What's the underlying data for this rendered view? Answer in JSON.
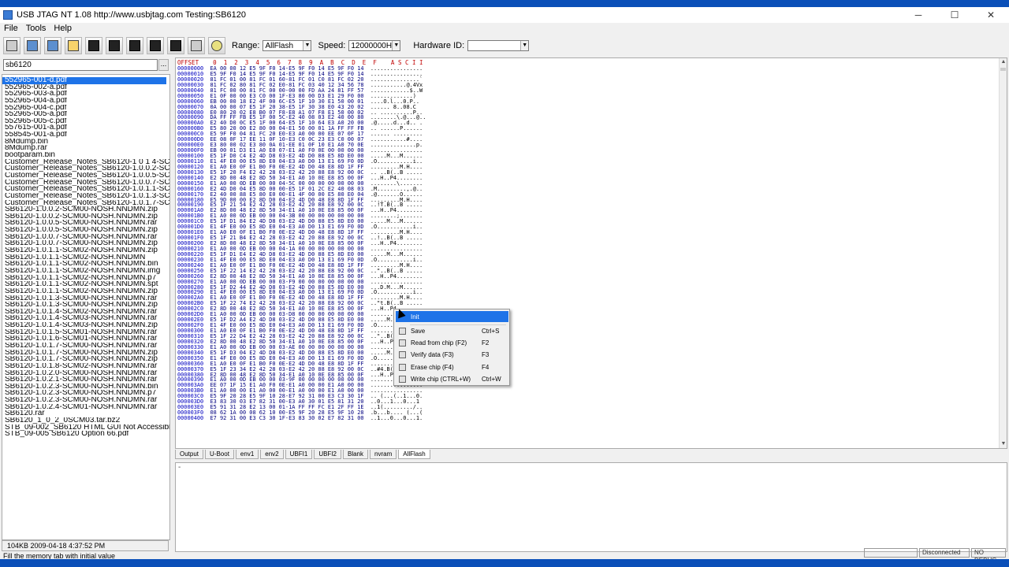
{
  "window": {
    "title": "USB JTAG NT  1.08 http://www.usbjtag.com   Testing:SB6120",
    "controls": [
      "─",
      "☐",
      "✕"
    ]
  },
  "menu": [
    "File",
    "Tools",
    "Help"
  ],
  "toolbar": {
    "range_label": "Range:",
    "range_value": "AllFlash",
    "speed_label": "Speed:",
    "speed_value": "12000000Hz",
    "hwid_label": "Hardware ID:",
    "hwid_value": ""
  },
  "search": {
    "value": "sb6120",
    "button": "..."
  },
  "files": [
    "552965-001-d.pdf",
    "552965-002-a.pdf",
    "552965-003-a.pdf",
    "552965-004-a.pdf",
    "552965-004-c.pdf",
    "552965-005-a.pdf",
    "552965-005-c.pdf",
    "557615-001-a.pdf",
    "558545-001-a.pdf",
    "8Mdump.bin",
    "8Mdump.rar",
    "bootparam.bin",
    "Customer_Release_Notes_SB6120-1 0 1 4-SCM03 (2).pdf",
    "Customer_Release_Notes_SB6120-1.0.0.2-SCM00.pdf",
    "Customer_Release_Notes_SB6120-1.0.0.5-SCM00.pdf",
    "Customer_Release_Notes_SB6120-1.0.0.7-SCM00.pdf",
    "Customer_Release_Notes_SB6120-1.0.1.1-SCM02a.pdf",
    "Customer_Release_Notes_SB6120-1.0.1.3-SCM00.pdf",
    "Customer_Release_Notes_SB6120-1.0.1.7-SCM00a.pdf",
    "SB6120-1.0.0.2-SCM00-NOSH.NNDMN.zip",
    "SB6120-1.0.0.2-SCM00-NOSH.NNDMN.zip",
    "SB6120-1.0.0.5-SCM00-NOSH.NNDMN.rar",
    "SB6120-1.0.0.5-SCM00-NOSH.NNDMN.zip",
    "SB6120-1.0.0.7-SCM00-NOSH.NNDMN.rar",
    "SB6120-1.0.0.7-SCM00-NOSH.NNDMN.zip",
    "SB6120-1.0.1.1-SCM02-NOSH.NNDMN.zip",
    "SB6120-1.0.1.1-SCM02-NOSH.NNDMN",
    "SB6120-1.0.1.1-SCM02-NOSH.NNDMN.bin",
    "SB6120-1.0.1.1-SCM02-NOSH.NNDMN.img",
    "SB6120-1.0.1.1-SCM02-NOSH.NNDMN.p7",
    "SB6120-1.0.1.1-SCM02-NOSH.NNDMN.spt",
    "SB6120-1.0.1.1-SCM02-NOSH.NNDMN.zip",
    "SB6120-1.0.1.3-SCM00-NOSH.NNDMN.rar",
    "SB6120-1.0.1.3-SCM00-NOSH.NNDMN.zip",
    "SB6120-1.0.1.4-SCM02-NOSH.NNDMN.rar",
    "SB6120-1.0.1.4-SCM03-NOSH.NNDMN.rar",
    "SB6120-1.0.1.4-SCM03-NOSH.NNDMN.zip",
    "SB6120-1.0.1.5-SCM01-NOSH.NNDMN.rar",
    "SB6120-1.0.1.6-SCM01-NOSH.NNDMN.rar",
    "SB6120-1.0.1.7-SCM00-NOSH.NNDMN.rar",
    "SB6120-1.0.1.7-SCM00-NOSH.NNDMN.zip",
    "SB6120-1.0.1.7-SCM00-NOSH.NNDMN.zip",
    "SB6120-1.0.1.8-SCM02-NOSH.NNDMN.rar",
    "SB6120-1.0.2.0-SCM00-NOSH.NNDMN.rar",
    "SB6120-1.0.2.1-SCM00-NOSH.NNDMN.rar",
    "SB6120-1.0.2.3-SCM00-NOSH.NNDMN.bin",
    "SB6120-1.0.2.3-SCM00-NOSH.NNDMN.p7",
    "SB6120-1.0.2.3-SCM00-NOSH.NNDMN.rar",
    "SB6120-1.0.2.4-SCM01-NOSH.NNDMN.rar",
    "SB6120.rar",
    "SB6120_1_0_2_0SCM03.tar.bz2",
    "STB_09-002_SB6120 HTML GUI Not Accessible.pdf",
    "STB_09-005 SB6120 Option 66.pdf"
  ],
  "file_info": "104KB    2009-04-18 4:37:52 PM",
  "hex_header": "OFFSET    0  1  2  3  4  5  6  7  8  9  A  B  C  D  E  F    A S C I I",
  "hex_rows": [
    [
      "00000000",
      "EA 00 00 12 E5 9F F0 14-E5 9F F0 14 E5 9F F0 14",
      "................"
    ],
    [
      "00000010",
      "E5 9F F0 14 E5 9F F0 14-E5 9F F0 14 E5 9F F0 14",
      "................"
    ],
    [
      "00000020",
      "81 FC 01 00 81 FC 01 60-81 FC 01 C0 81 FC 02 20",
      "...............`"
    ],
    [
      "00000030",
      "81 FC 02 80 81 FC 02 E0-81 FC 03 40 12 34 56 78",
      "...........@.4Vx"
    ],
    [
      "00000040",
      "81 FC 00 00 81 FC 00 00-00 00 FD AA 24 81 FF 57",
      "............$..W"
    ],
    [
      "00000050",
      "E1 0F 00 00 E3 C0 00 1F-E3 80 00 D3 E1 29 F0 00",
      ".............)"
    ],
    [
      "00000060",
      "EB 00 00 18 E2 4F 00 6C-E5 1F 10 30 E1 50 00 01",
      "....O.l...0.P.."
    ],
    [
      "00000070",
      "0A 00 00 07 E5 1F 20 38-E5 1F 30 38 E0 43 20 02",
      "...... 8..08.C "
    ],
    [
      "00000080",
      "E0 80 20 02 E8 B0 07 F8-E8 A1 07 F8 E1 50 00 02",
      ".. ..........P.."
    ],
    [
      "00000090",
      "DA FF FF FB E5 1F 00 5C-E2 40 08 03 E2 40 00 80",
      "........\\.@...@.."
    ],
    [
      "000000A0",
      "E2 40 D0 0C E5 1F 00 64-E5 1F 10 64 E3 A0 20 00",
      ".@.....d...d.. ."
    ],
    [
      "000000B0",
      "E5 80 20 00 E2 80 00 04-E1 50 00 01 1A FF FF FB",
      ".. ......P......"
    ],
    [
      "000000C0",
      "E5 9F F0 04 81 FC 20 E0-E3 A0 00 00 EE 07 0F 17",
      "...... ........."
    ],
    [
      "000000D0",
      "EE 08 0F 17 EE 11 0F 10-E3 C0 0C 23 E3 C0 00 07",
      "...........#...."
    ],
    [
      "000000E0",
      "E3 80 00 02 E3 80 0A 01-EE 01 0F 10 E1 A0 70 0E",
      "..............p."
    ],
    [
      "000000F0",
      "EB 00 01 D3 E1 A0 E0 07-E1 A0 F0 0E 00 00 00 00",
      "................"
    ],
    [
      "00000100",
      "E5 1F D0 C4 E2 4D D8 03-E2 4D D0 88 E5 8D E0 00",
      ".....M...M......"
    ],
    [
      "00000110",
      "E1 4F E0 00 E5 8D E0 04-E3 A0 D0 13 E1 69 F0 0D",
      ".O...........i.."
    ],
    [
      "00000120",
      "E1 A0 E0 0F E1 B0 F0 0E-E2 4D D0 48 E8 8D 1F FF",
      ".........M.H...."
    ],
    [
      "00000130",
      "E5 1F 20 F4 E2 42 28 03-E2 42 20 88 E8 92 00 0C",
      ".. ..B(..B ....."
    ],
    [
      "00000140",
      "E2 8D 00 48 E2 8D 50 34-E1 A0 10 0E E8 85 00 0F",
      "...H..P4........"
    ],
    [
      "00000150",
      "E1 A0 00 0D EB 00 00 04-5C 00 00 00 00 00 00 00",
      "........\\......."
    ],
    [
      "00000160",
      "E2 4D D0 04 E5 8D 00 00-E5 1F 01 2C E2 40 08 03",
      ".M.........,.@.."
    ],
    [
      "00000170",
      "E2 40 00 88 E5 80 E0 00-E1 4F 00 00 E5 80 E0 04",
      ".@.......O......"
    ],
    [
      "00000180",
      "E5 9D 00 00 E2 8D D0 04-E2 4D D0 48 E8 8D 1F FF",
      ".........M.H...."
    ],
    [
      "00000190",
      "E5 1F 21 54 E2 42 28 03-E2 42 20 88 E8 92 00 0C",
      "..!T.B(..B ....."
    ],
    [
      "000001A0",
      "E2 8D 00 48 E2 8D 50 34-E1 A0 10 0E E8 85 00 0F",
      "...H..P4........"
    ],
    [
      "000001B0",
      "E1 A0 00 0D EB 00 00 04-3B 00 00 00 00 00 00 00",
      "........;......."
    ],
    [
      "000001C0",
      "E5 1F D1 84 E2 4D D8 03-E2 4D D0 88 E5 8D E0 00",
      ".....M...M......"
    ],
    [
      "000001D0",
      "E1 4F E0 00 E5 8D E0 04-E3 A0 D0 13 E1 69 F0 0D",
      ".O...........i.."
    ],
    [
      "000001E0",
      "E1 A0 E0 0F E1 B0 F0 0E-E2 4D D0 48 E8 8D 1F FF",
      ".........M.H...."
    ],
    [
      "000001F0",
      "E5 1F 21 B4 E2 42 28 03-E2 42 20 88 E8 92 00 0C",
      "..!..B(..B ....."
    ],
    [
      "00000200",
      "E2 8D 00 48 E2 8D 50 34-E1 A0 10 0E E8 85 00 0F",
      "...H..P4........"
    ],
    [
      "00000210",
      "E1 A0 00 0D EB 00 00 04-1A 00 00 00 00 00 00 00",
      "................"
    ],
    [
      "00000220",
      "E5 1F D1 E4 E2 4D D8 03-E2 4D D0 88 E5 8D E0 00",
      ".....M...M......"
    ],
    [
      "00000230",
      "E1 4F E0 00 E5 8D E0 04-E3 A0 D0 13 E1 69 F0 0D",
      ".O...........i.."
    ],
    [
      "00000240",
      "E1 A0 E0 0F E1 B0 F0 0E-E2 4D D0 48 E8 8D 1F FF",
      ".........M.H...."
    ],
    [
      "00000250",
      "E5 1F 22 14 E2 42 28 03-E2 42 20 88 E8 92 00 0C",
      "..\"..B(..B ....."
    ],
    [
      "00000260",
      "E2 8D 00 48 E2 8D 50 34-E1 A0 10 0E E8 85 00 0F",
      "...H..P4........"
    ],
    [
      "00000270",
      "E1 A0 00 0D EB 00 00 03-F9 00 00 00 00 00 00 00",
      "................"
    ],
    [
      "00000280",
      "E5 1F D2 44 E2 4D D8 03-E2 4D D0 88 E5 8D E0 00",
      "...D.M...M......"
    ],
    [
      "00000290",
      "E1 4F E0 00 E5 8D E0 04-E3 A0 D0 13 E1 69 F0 0D",
      ".O...........i.."
    ],
    [
      "000002A0",
      "E1 A0 E0 0F E1 B0 F0 0E-E2 4D D0 48 E8 8D 1F FF",
      ".........M.H...."
    ],
    [
      "000002B0",
      "E5 1F 22 74 E2 42 28 03-E2 42 20 88 E8 92 00 0C",
      "..\"t.B(..B ....."
    ],
    [
      "000002C0",
      "E2 8D 00 48 E2 8D 50 34-E1 A0 10 0E E8 85 00 0F",
      "...H..P4........"
    ],
    [
      "000002D0",
      "E1 A0 00 0D EB 00 00 03-D8 00 00 00 00 00 00 00",
      "................"
    ],
    [
      "000002E0",
      "E5 1F D2 A4 E2 4D D8 03-E2 4D D0 88 E5 8D E0 00",
      ".....M...M......"
    ],
    [
      "000002F0",
      "E1 4F E0 00 E5 8D E0 04-E3 A0 D0 13 E1 69 F0 0D",
      ".O...........i.."
    ],
    [
      "00000300",
      "E1 A0 E0 0F E1 B0 F0 0E-E2 4D D0 48 E8 8D 1F FF",
      ".........M.H...."
    ],
    [
      "00000310",
      "E5 1F 22 D4 E2 42 28 03-E2 42 20 88 E8 92 00 0C",
      "..\"..B(..B ....."
    ],
    [
      "00000320",
      "E2 8D 00 48 E2 8D 50 34-E1 A0 10 0E E8 85 00 0F",
      "...H..P4........"
    ],
    [
      "00000330",
      "E1 A0 00 0D EB 00 00 03-AE 00 00 00 00 00 00 00",
      "................"
    ],
    [
      "00000340",
      "E5 1F D3 04 E2 4D D8 03-E2 4D D0 88 E5 8D E0 00",
      ".....M...M......"
    ],
    [
      "00000350",
      "E1 4F E0 00 E5 8D E0 04-E3 A0 D0 13 E1 69 F0 0D",
      ".O...........i.."
    ],
    [
      "00000360",
      "E1 A0 E0 0F E1 B0 F0 0E-E2 4D D0 48 E8 8D 1F FF",
      ".........M.H...."
    ],
    [
      "00000370",
      "E5 1F 23 34 E2 42 28 03-E2 42 20 88 E8 92 00 0C",
      "..#4.B(..B ....."
    ],
    [
      "00000380",
      "E2 8D 00 48 E2 8D 50 34-E1 A0 10 0E E8 85 00 0F",
      "...H..P4........"
    ],
    [
      "00000390",
      "E1 A0 00 0D EB 00 00 03-9F 00 00 00 00 00 00 00",
      "................"
    ],
    [
      "000003A0",
      "EE 07 1F 15 E1 A0 F0 0E-E1 A0 00 00 E1 A0 00 00",
      "................"
    ],
    [
      "000003B0",
      "E1 A0 00 00 E1 A0 00 00-E1 A0 00 00 E1 A0 00 00",
      "................"
    ],
    [
      "000003C0",
      "E5 9F 20 28 E5 9F 10 28-E7 92 31 00 E3 C3 30 1F",
      ".. (...(..1...0."
    ],
    [
      "000003D0",
      "E3 83 30 03 E7 82 31 00-E3 A0 30 01 E5 81 31 20",
      "..0...1...0...1 "
    ],
    [
      "000003E0",
      "E5 91 31 28 E2 13 00 01-1A FF FF FC E1 2F FF 1E",
      "..1(........./.."
    ],
    [
      "000003F0",
      "08 62 1A 00 08 62 10 00-E5 9F 20 28 E5 9F 10 28",
      ".b...b.... (...("
    ],
    [
      "00000400",
      "E7 92 31 00 E3 C3 30 1F-E3 83 30 02 E7 82 31 00",
      "..1...0...0...1."
    ]
  ],
  "tabs": [
    "Output",
    "U-Boot",
    "env1",
    "env2",
    "UBFI1",
    "UBFI2",
    "Blank",
    "nvram",
    "AllFlash"
  ],
  "active_tab": "AllFlash",
  "output_text": "-",
  "status_text": "Fill the memory tab with initial value",
  "status_fields": [
    "",
    "Disconnected",
    "NO DEBUG"
  ],
  "context_menu": [
    {
      "label": "Init",
      "shortcut": "",
      "icon": "init-icon"
    },
    {
      "label": "Save",
      "shortcut": "Ctrl+S",
      "icon": "save-icon"
    },
    {
      "label": "Read from chip (F2)",
      "shortcut": "F2",
      "icon": "read-chip-icon"
    },
    {
      "label": "Verify data (F3)",
      "shortcut": "F3",
      "icon": "verify-icon"
    },
    {
      "label": "Erase chip (F4)",
      "shortcut": "F4",
      "icon": "erase-icon"
    },
    {
      "label": "Write chip (CTRL+W)",
      "shortcut": "Ctrl+W",
      "icon": "write-chip-icon"
    }
  ],
  "colors": {
    "accent": "#1e73e8",
    "offset": "#0000c0",
    "header": "#c00000",
    "desktop": "#0a4fb8"
  }
}
